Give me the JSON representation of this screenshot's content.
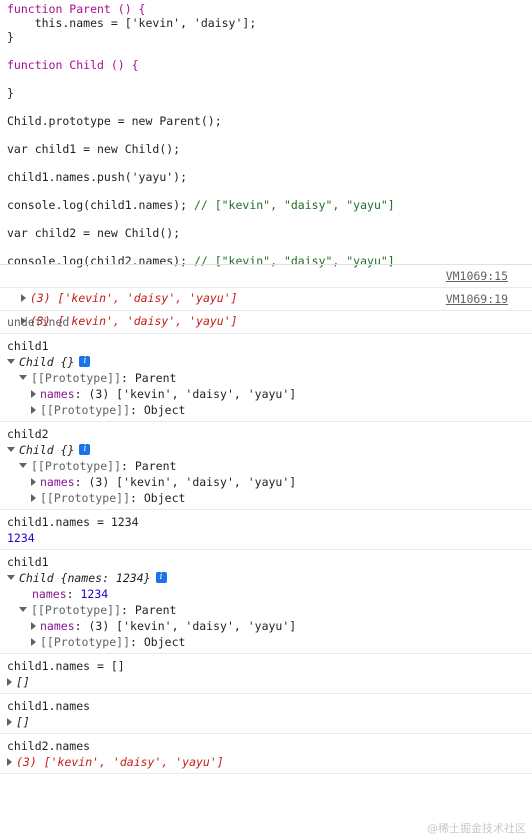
{
  "code": {
    "l1": "function Parent () {",
    "l2": "    this.names = ['kevin', 'daisy'];",
    "l3": "}",
    "l4": "function Child () {",
    "l5": "}",
    "l6": "Child.prototype = new Parent();",
    "l7": "var child1 = new Child();",
    "l8": "child1.names.push('yayu');",
    "l9a": "console.log(child1.names);",
    "l9b": " // [\"kevin\", \"daisy\", \"yayu\"]",
    "l10": "var child2 = new Child();",
    "l11a": "console.log(child2.names);",
    "l11b": " // [\"kevin\", \"daisy\", \"yayu\"]"
  },
  "logs": [
    {
      "text": "(3) ['kevin', 'daisy', 'yayu']",
      "source": "VM1069:15"
    },
    {
      "text": "(3) ['kevin', 'daisy', 'yayu']",
      "source": "VM1069:19"
    }
  ],
  "console": {
    "undefined": "undefined",
    "b1": {
      "cmd": "child1",
      "obj": "Child {}",
      "proto_key": "[[Prototype]]",
      "proto_val": "Parent",
      "names_key": "names",
      "names_val": "(3) ['kevin', 'daisy', 'yayu']",
      "proto2_key": "[[Prototype]]",
      "proto2_val": "Object"
    },
    "b2": {
      "cmd": "child2",
      "obj": "Child {}",
      "proto_key": "[[Prototype]]",
      "proto_val": "Parent",
      "names_key": "names",
      "names_val": "(3) ['kevin', 'daisy', 'yayu']",
      "proto2_key": "[[Prototype]]",
      "proto2_val": "Object"
    },
    "b3": {
      "cmd": "child1.names = 1234",
      "result": "1234"
    },
    "b4": {
      "cmd": "child1",
      "obj": "Child {names: 1234}",
      "own_key": "names",
      "own_val": "1234",
      "proto_key": "[[Prototype]]",
      "proto_val": "Parent",
      "names_key": "names",
      "names_val": "(3) ['kevin', 'daisy', 'yayu']",
      "proto2_key": "[[Prototype]]",
      "proto2_val": "Object"
    },
    "b5": {
      "cmd": "child1.names = []",
      "result": "[]"
    },
    "b6": {
      "cmd": "child1.names",
      "result": "[]"
    },
    "b7": {
      "cmd": "child2.names",
      "result": "(3) ['kevin', 'daisy', 'yayu']"
    }
  },
  "watermark": "@稀土掘金技术社区",
  "info_glyph": "i",
  "colors": {
    "keyword": "#aa0d91",
    "string": "#c41a16",
    "comment": "#236e25",
    "number": "#1c00cf",
    "info": "#1a73e8"
  }
}
